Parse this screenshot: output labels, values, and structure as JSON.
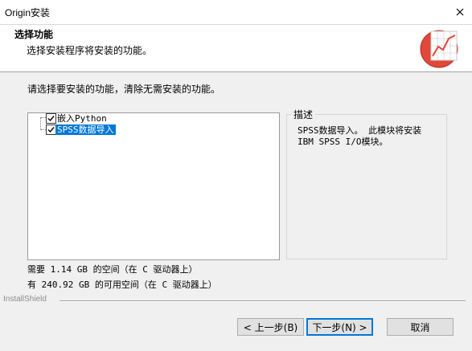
{
  "window": {
    "title": "Origin安装",
    "close_label": "×"
  },
  "header": {
    "title": "选择功能",
    "subtitle": "选择安装程序将安装的功能。",
    "logo_icon": "origin-graph-icon"
  },
  "instruction": "请选择要安装的功能，清除无需安装的功能。",
  "features": [
    {
      "label": "嵌入Python",
      "checked": true,
      "selected": false
    },
    {
      "label": "SPSS数据导入",
      "checked": true,
      "selected": true
    }
  ],
  "description": {
    "legend": "描述",
    "text": "SPSS数据导入。 此模块将安装 IBM SPSS I/O模块。"
  },
  "space": {
    "required": "需要 1.14 GB 的空间（在 C 驱动器上）",
    "available": "有 240.92 GB 的可用空间（在 C 驱动器上）"
  },
  "brand": "InstallShield",
  "buttons": {
    "back": "< 上一步(B)",
    "next": "下一步(N) >",
    "cancel": "取消"
  },
  "colors": {
    "selection": "#0078d7",
    "logo_red": "#e0483a"
  }
}
